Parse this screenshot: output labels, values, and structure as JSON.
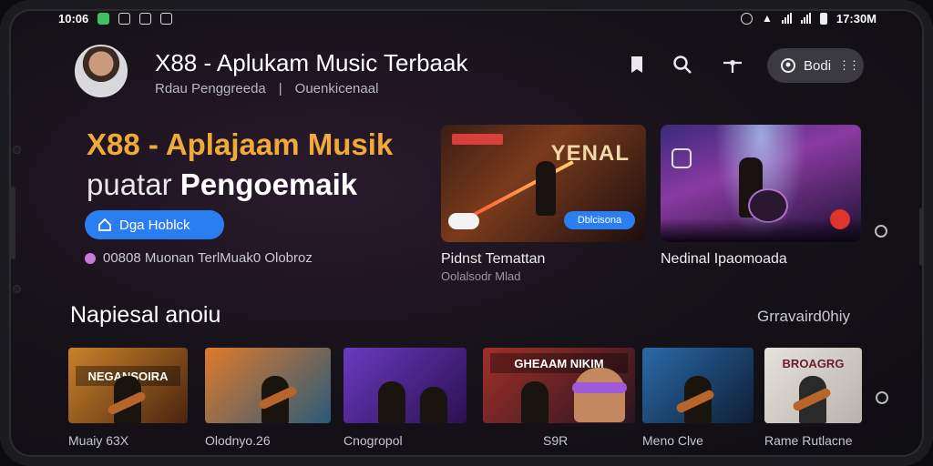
{
  "status": {
    "time": "10:06",
    "clock": "17:30M"
  },
  "header": {
    "title": "X88 - Aplukam Music Terbaak",
    "subtitle_left": "Rdau Penggreeda",
    "subtitle_sep": "|",
    "subtitle_right": "Ouenkicenaal",
    "pill_label": "Bodi"
  },
  "hero": {
    "title_line1": "X88 - Aplajaam Musik",
    "title_line2_a": "puatar ",
    "title_line2_b": "Pengoemaik",
    "cta_label": "Dga Hoblck",
    "meta": "00808 Muonan TerlMuak0 Olobroz"
  },
  "featured": [
    {
      "title": "Pidnst Temattan",
      "subtitle": "Oolalsodr Mlad",
      "chip": "Dblcisona",
      "poster_text": "YENAL"
    },
    {
      "title": "Nedinal Ipaomoada",
      "subtitle": ""
    }
  ],
  "section": {
    "title": "Napiesal anoiu",
    "link": "Grravaird0hiy"
  },
  "thumbs": [
    {
      "label": "Muaiy 63X",
      "banner": "NEGANSOIRA",
      "color1": "#c9822a",
      "color2": "#4a2410"
    },
    {
      "label": "Olodnyo.26",
      "banner": "",
      "color1": "#e07a2a",
      "color2": "#2a5a7a"
    },
    {
      "label": "Cnogropol",
      "banner": "",
      "color1": "#6a3ac0",
      "color2": "#2a1050"
    },
    {
      "label": "S9R",
      "banner": "GHEAAM NIKIM",
      "color1": "#a0302a",
      "color2": "#2a1420"
    },
    {
      "label": "Meno Clve",
      "banner": "",
      "color1": "#2a6aa8",
      "color2": "#0e1e34"
    },
    {
      "label": "Rame Rutlacne",
      "banner": "BROAGRG",
      "color1": "#e6e2dc",
      "color2": "#b8b2aa"
    }
  ]
}
